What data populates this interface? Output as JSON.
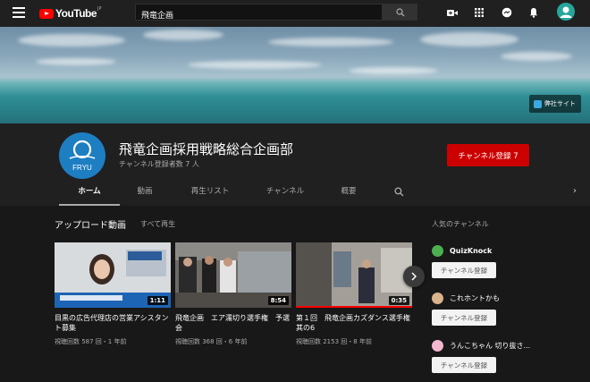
{
  "header": {
    "logo_text": "YouTube",
    "logo_region": "JP",
    "search_value": "飛竜企画",
    "search_placeholder": "検索"
  },
  "banner": {
    "link_label": "弊社サイト"
  },
  "channel": {
    "name": "飛竜企画採用戦略総合企画部",
    "subscribers": "チャンネル登録者数 7 人",
    "subscribe_label": "チャンネル登録  7",
    "avatar_text": "FRYU"
  },
  "tabs": [
    {
      "label": "ホーム"
    },
    {
      "label": "動画"
    },
    {
      "label": "再生リスト"
    },
    {
      "label": "チャンネル"
    },
    {
      "label": "概要"
    }
  ],
  "uploads": {
    "title": "アップロード動画",
    "play_all": "すべて再生",
    "videos": [
      {
        "title": "目黒の広告代理店の営業アシスタント募集",
        "meta": "視聴回数 587 回・1 年前",
        "duration": "1:11",
        "progress": 0
      },
      {
        "title": "飛竜企画　エア濡切り選手権　予選会",
        "meta": "視聴回数 368 回・6 年前",
        "duration": "8:54",
        "progress": 0
      },
      {
        "title": "第１回　飛竜企画カズダンス選手権　其の6",
        "meta": "視聴回数 2153 回・8 年前",
        "duration": "0:35",
        "progress": 1
      }
    ]
  },
  "sidebar": {
    "title": "人気のチャンネル",
    "channels": [
      {
        "name": "QuizKnock",
        "button": "チャンネル登録",
        "color": "#4caf50"
      },
      {
        "name": "これホントかも",
        "button": "チャンネル登録",
        "color": "#d9b38c"
      },
      {
        "name": "うんこちゃん 切り抜さ...",
        "button": "チャンネル登録",
        "color": "#f3b7d0"
      }
    ]
  },
  "colors": {
    "accent": "#cc0000",
    "background": "#181818",
    "header": "#202020"
  }
}
